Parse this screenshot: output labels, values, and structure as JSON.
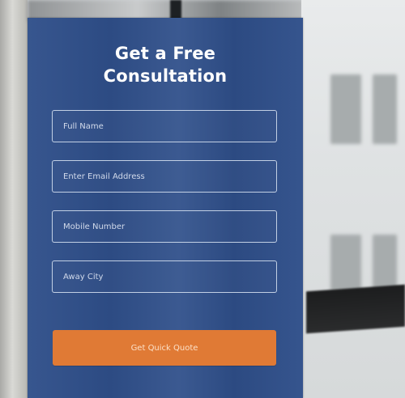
{
  "form": {
    "title_line1": "Get a Free",
    "title_line2": "Consultation",
    "fields": [
      {
        "placeholder": "Full Name"
      },
      {
        "placeholder": "Enter Email Address"
      },
      {
        "placeholder": "Mobile Number"
      },
      {
        "placeholder": "Away City"
      }
    ],
    "submit_label": "Get Quick Quote"
  },
  "colors": {
    "card_background": "#2f4f8a",
    "button_background": "#e07a35",
    "text": "#ffffff"
  }
}
